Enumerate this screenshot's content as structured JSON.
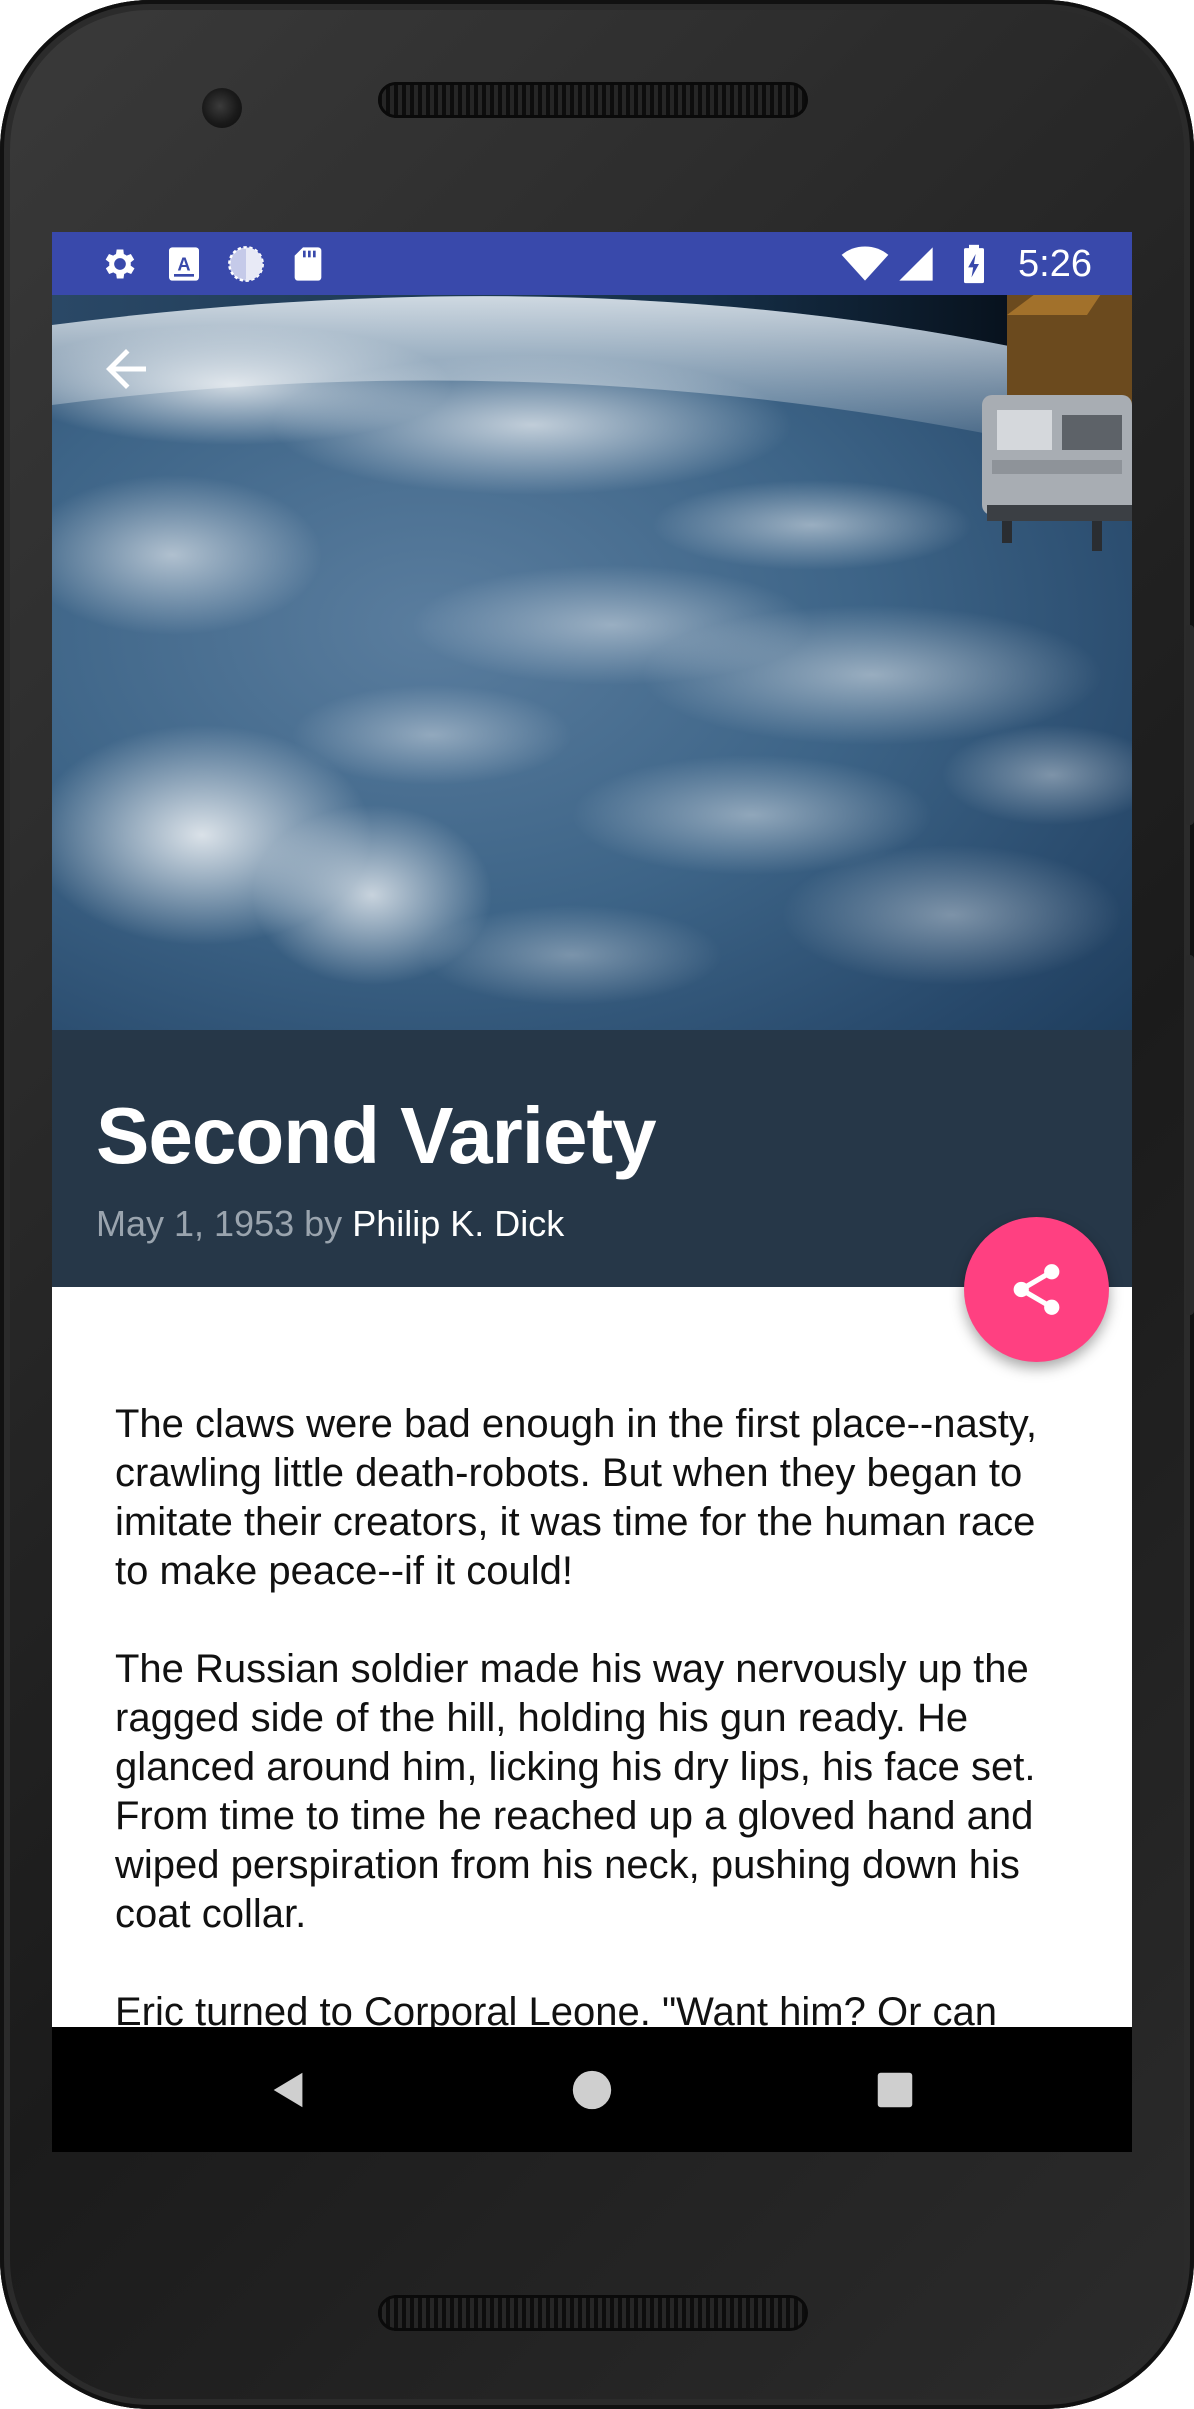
{
  "status_bar": {
    "time": "5:26",
    "left_icons": [
      "settings-icon",
      "a-notification-icon",
      "sync-circle-icon",
      "sd-card-icon"
    ],
    "right_icons": [
      "wifi-icon",
      "signal-icon",
      "battery-charging-icon"
    ],
    "color": "#3949ab"
  },
  "article": {
    "title": "Second Variety",
    "date": "May 1, 1953",
    "by": "by",
    "author": "Philip K. Dick",
    "paragraphs": [
      "The claws were bad enough in the first place--nasty, crawling little death-robots. But when they began to imitate their creators, it was time for the human race to make peace--if it could!",
      "The Russian soldier made his way nervously up the ragged side of the hill, holding his gun ready. He glanced around him, licking his dry lips, his face set. From time to time he reached up a gloved hand and wiped perspiration from his neck, pushing down his coat collar.",
      "Eric turned to Corporal Leone. \"Want him? Or can"
    ]
  },
  "hero_image": "earth-from-orbit-with-satellite",
  "fab": {
    "icon": "share-icon",
    "color": "#ff4081"
  },
  "nav_bar": {
    "buttons": [
      "back-triangle-icon",
      "home-circle-icon",
      "recents-square-icon"
    ]
  }
}
